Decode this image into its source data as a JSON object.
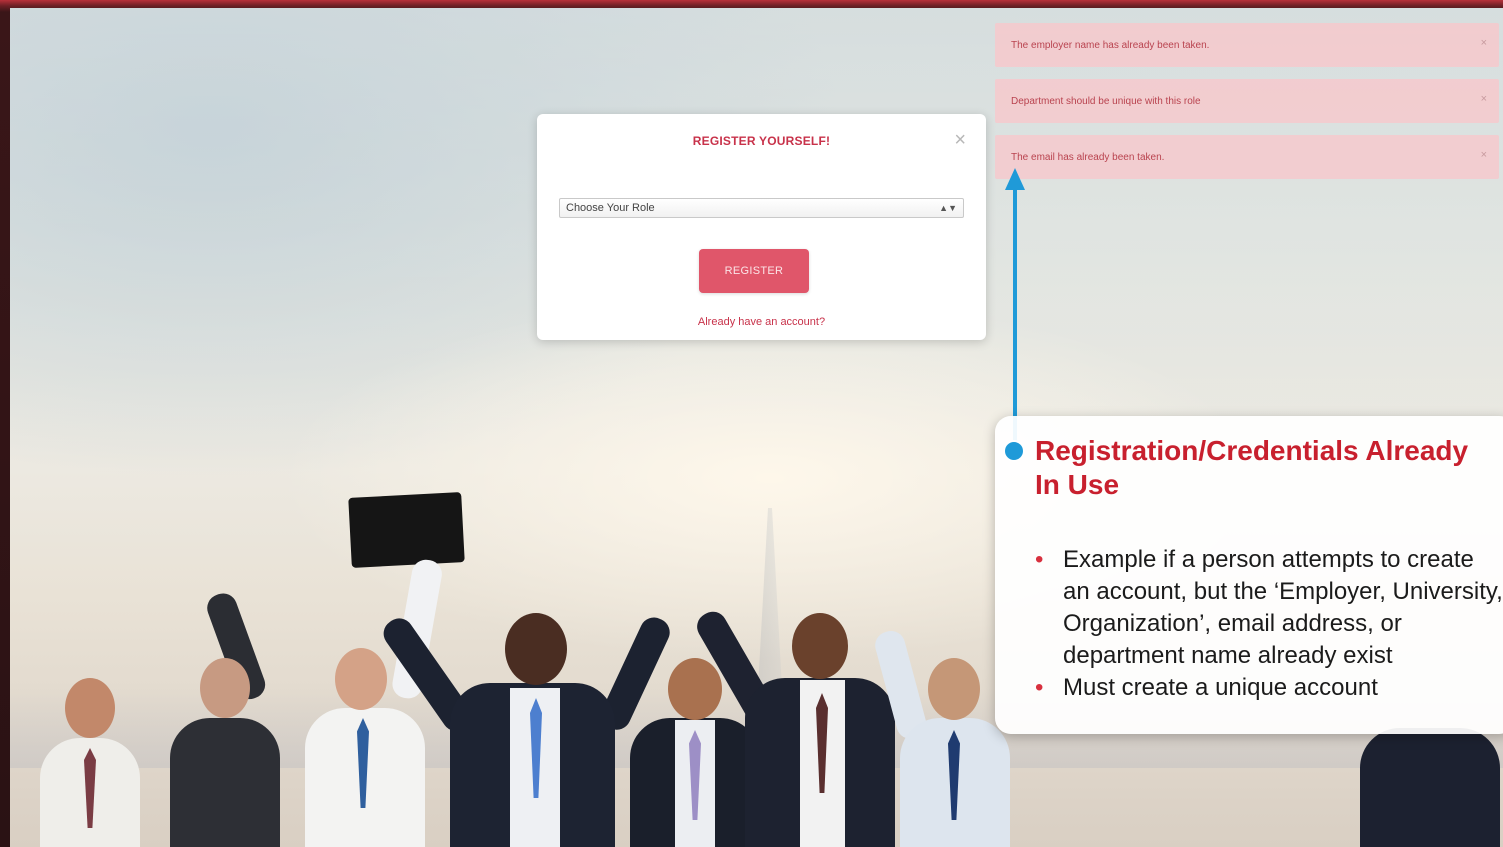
{
  "modal": {
    "title": "REGISTER YOURSELF!",
    "close": "×",
    "role_select": "Choose Your Role",
    "register_button": "REGISTER",
    "already_link": "Already have an account?"
  },
  "alerts": [
    {
      "message": "The employer name has already been taken.",
      "close": "×"
    },
    {
      "message": "Department should be unique with this role",
      "close": "×"
    },
    {
      "message": "The email has already been taken.",
      "close": "×"
    }
  ],
  "callout": {
    "title": "Registration/Credentials Already In Use",
    "bullets": [
      "Example if a person attempts to create an account, but the ‘Employer, University, Organization’, email address, or department name already exist",
      "Must create a unique account"
    ]
  },
  "colors": {
    "accent": "#c8324a",
    "button": "#e0566a",
    "callout_title": "#c8202e",
    "arrow": "#1f9ad8",
    "alert_bg": "#f5c9cd"
  }
}
